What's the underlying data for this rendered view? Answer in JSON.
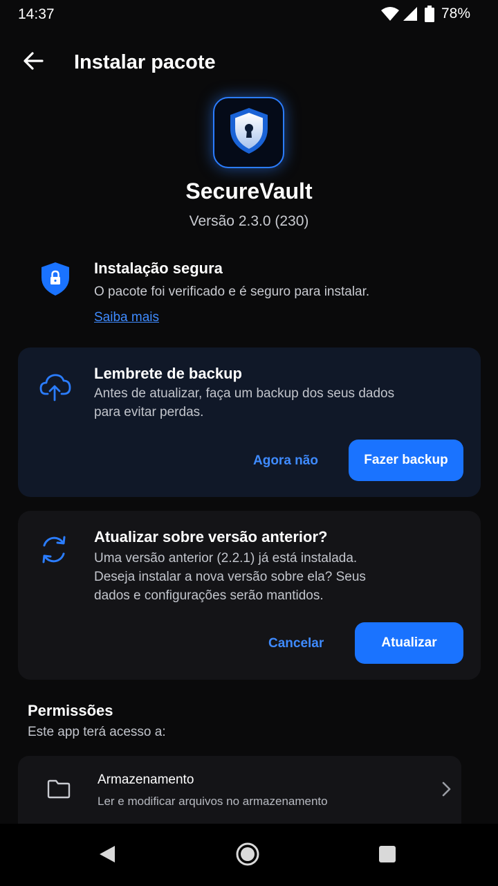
{
  "status_bar": {
    "time": "14:37",
    "battery": "78%",
    "icons": [
      "wifi-icon",
      "signal-icon",
      "battery-icon"
    ]
  },
  "app_bar": {
    "title": "Instalar pacote",
    "back_icon": "arrow-left-icon"
  },
  "app": {
    "name": "SecureVault",
    "version": "Versão 2.3.0 (230)",
    "icon": "shield-keyhole-icon"
  },
  "secure": {
    "title": "Instalação segura",
    "description": "O pacote foi verificado e é seguro para instalar.",
    "link": "Saiba mais",
    "icon": "shield-lock-icon"
  },
  "backup_card": {
    "title": "Lembrete de backup",
    "description_line1": "Antes de atualizar, faça um backup dos seus dados",
    "description_line2": "para evitar perdas.",
    "secondary_action": "Agora não",
    "primary_action": "Fazer backup",
    "icon": "cloud-upload-icon"
  },
  "update_card": {
    "title": "Atualizar sobre versão anterior?",
    "description_line1": "Uma versão anterior (2.2.1) já está instalada.",
    "description_line2": "Deseja instalar a nova versão sobre ela? Seus",
    "description_line3": "dados e configurações serão mantidos.",
    "secondary_action": "Cancelar",
    "primary_action": "Atualizar",
    "icon": "refresh-icon"
  },
  "permissions": {
    "title": "Permissões",
    "subtitle": "Este app terá acesso a:",
    "items": [
      {
        "name": "Armazenamento",
        "description": "Ler e modificar arquivos no armazenamento",
        "icon": "folder-icon"
      }
    ]
  },
  "nav_bar": {
    "buttons": [
      "back-triangle-icon",
      "home-circle-icon",
      "recents-square-icon"
    ]
  },
  "colors": {
    "accent": "#1a73ff",
    "link": "#3f8bff",
    "background": "#0a0a0b",
    "card": "#141417",
    "backup_card": "#101828"
  }
}
